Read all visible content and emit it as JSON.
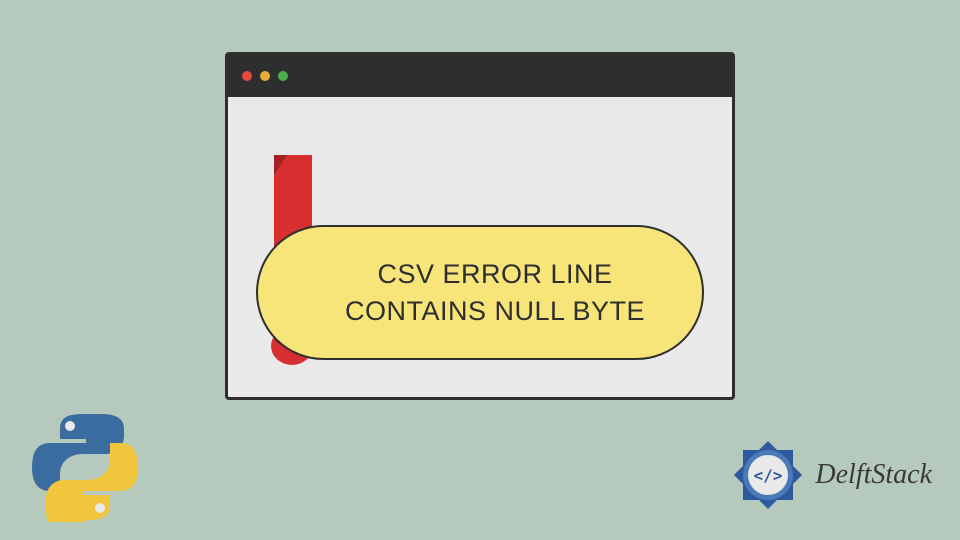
{
  "message": {
    "line1": "CSV ERROR LINE",
    "line2": "CONTAINS NULL BYTE"
  },
  "brand": {
    "name": "DelftStack"
  },
  "colors": {
    "background": "#b6c9bd",
    "window_bg": "#e9e9e9",
    "titlebar": "#2e2e2e",
    "pill": "#f7e57a",
    "exclaim": "#d72f2f",
    "python_blue": "#3b6ca0",
    "python_yellow": "#f2c63c",
    "delft_blue": "#2d5a9e"
  }
}
